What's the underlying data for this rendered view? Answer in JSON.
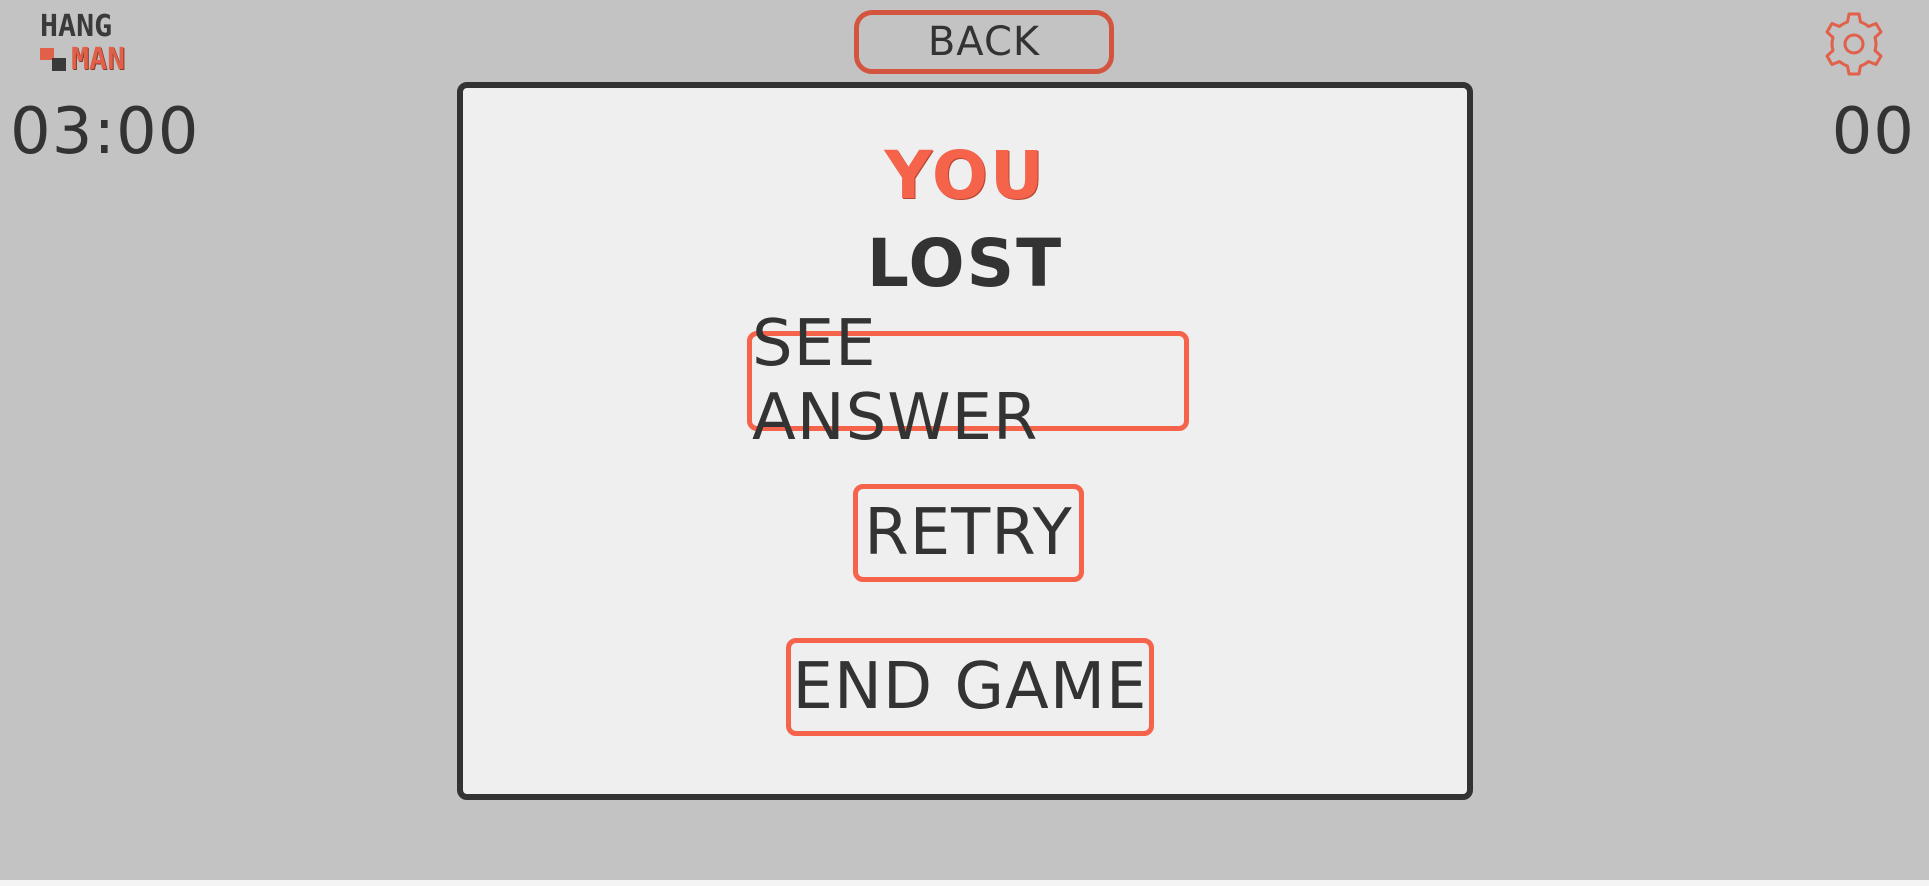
{
  "app": {
    "logo_top": "HANG",
    "logo_bottom": "MAN"
  },
  "header": {
    "back_label": "BACK",
    "timer": "03:00",
    "score": "00",
    "settings_icon": "gear-icon"
  },
  "modal": {
    "title_line1": "YOU",
    "title_line2": "LOST",
    "buttons": {
      "see_answer": "SEE ANSWER",
      "retry": "RETRY",
      "end_game": "END GAME"
    }
  },
  "colors": {
    "accent": "#f4634a",
    "back_border": "#d4553f",
    "text_dark": "#333333",
    "background": "#c3c3c3",
    "modal_bg": "#efefef"
  }
}
